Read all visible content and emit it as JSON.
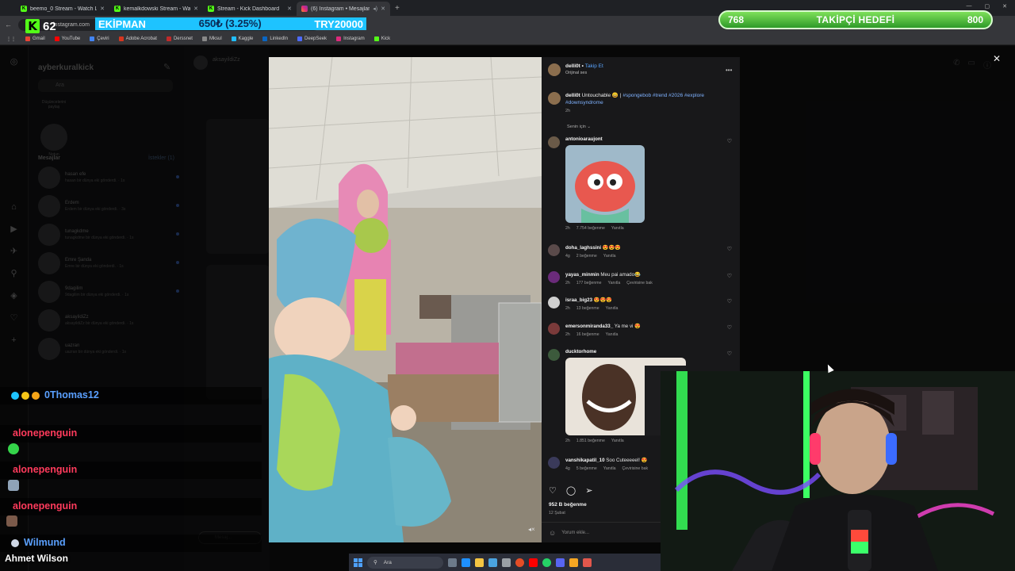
{
  "browser": {
    "tabs": [
      {
        "title": "beemo_0 Stream - Watch Live",
        "icon": "kick-icon"
      },
      {
        "title": "kemalkdowski Stream - Watch L",
        "icon": "kick-icon"
      },
      {
        "title": "Stream - Kick Dashboard",
        "icon": "kick-icon"
      },
      {
        "title": "(6) Instagram • Mesajlar",
        "icon": "instagram-icon",
        "active": true
      }
    ],
    "url": "instagram.com",
    "bookmarks": [
      "Gmail",
      "YouTube",
      "Çeviri",
      "Adobe Acrobat",
      "Derssnet",
      "Mksul",
      "Kaggle",
      "LinkedIn",
      "DeepSeek",
      "Instagram",
      "Kick"
    ]
  },
  "stream": {
    "viewer_count": "62",
    "ticker": {
      "left": "EKİPMAN",
      "middle": "650₺ (3.25%)",
      "right": "TRY20000"
    },
    "goal": {
      "current": "768",
      "label": "TAKİPÇİ HEDEFİ",
      "target": "800",
      "progress": 0.96
    }
  },
  "inbox": {
    "username": "ayberkuralkick",
    "search_placeholder": "Ara",
    "note_text": "Düşüncelerini paylaş",
    "note_label": "Notun",
    "header": "Mesajlar",
    "requests": "İstekler (1)",
    "threads": [
      {
        "name": "hasan efe",
        "preview": "hasan bir dünya eki gönderdi. · 1s"
      },
      {
        "name": "Erdem",
        "preview": "Erdem bir dünya eki gönderdi. · 3s"
      },
      {
        "name": "tunagkdme",
        "preview": "tunagkdme bir dünya eki gönderdi. · 1s"
      },
      {
        "name": "Emre Şanda",
        "preview": "Emre bir dünya eki gönderdi. · 1s"
      },
      {
        "name": "9dagilim",
        "preview": "9dagilim bir dünya eki gönderdi. · 1s"
      },
      {
        "name": "aksayildiZz",
        "preview": "aksayildiZz bir dünya eki gönderdi. · 1s"
      },
      {
        "name": "uazran",
        "preview": "uazran bir dünya eki gönderdi. · 1s"
      }
    ],
    "mid_user": "aksayildiZz",
    "message_placeholder": "Mesaj..."
  },
  "post": {
    "author": "delli0t",
    "follow": "Takip Et",
    "audio": "Orijinal ses",
    "caption_user": "delli0t",
    "caption_text": "Untouchable 😄 |",
    "caption_tags": "#spongebob #trend #2026 #explore #downsyndrome",
    "caption_time": "2h",
    "for_you": "Senin için ⌄",
    "comments": [
      {
        "user": "antonioaraujont",
        "text": "",
        "time": "2h",
        "likes": "7.754 beğenme",
        "reply": "Yanıtla",
        "translate": "",
        "has_image": true
      },
      {
        "user": "doha_laghssini",
        "text": "😍😍😍",
        "time": "4g",
        "likes": "2 beğenme",
        "reply": "Yanıtla",
        "translate": ""
      },
      {
        "user": "yayas_minmin",
        "text": "Meu pai amado😂",
        "time": "2h",
        "likes": "177 beğenme",
        "reply": "Yanıtla",
        "translate": "Çevirisine bak"
      },
      {
        "user": "israa_big23",
        "text": "😍😍😍",
        "time": "2h",
        "likes": "13 beğenme",
        "reply": "Yanıtla",
        "translate": ""
      },
      {
        "user": "emersonmiranda33_",
        "text": "Ya me vi 😍",
        "time": "2h",
        "likes": "16 beğenme",
        "reply": "Yanıtla",
        "translate": ""
      },
      {
        "user": "ducktorhome",
        "text": "",
        "time": "2h",
        "likes": "1.851 beğenme",
        "reply": "Yanıtla",
        "translate": "",
        "has_image": true
      },
      {
        "user": "vanshikapatil_10",
        "text": "Soo Cuteeeeel! 😍",
        "time": "4g",
        "likes": "5 beğenme",
        "reply": "Yanıtla",
        "translate": "Çevirisine bak"
      }
    ],
    "like_count": "952 B beğenme",
    "date": "12 Şubat",
    "add_comment": "Yorum ekle..."
  },
  "chat": {
    "messages": [
      {
        "user": "0Thomas12",
        "color": "#5aa0ff"
      },
      {
        "user": "alonepenguin",
        "color": "#ff3b5c"
      },
      {
        "user": "alonepenguin",
        "color": "#ff3b5c"
      },
      {
        "user": "alonepenguin",
        "color": "#ff3b5c"
      },
      {
        "user": "Wilmund",
        "color": "#5aa0ff"
      }
    ],
    "bottom_name": "Ahmet Wilson"
  },
  "taskbar": {
    "search": "Ara"
  }
}
